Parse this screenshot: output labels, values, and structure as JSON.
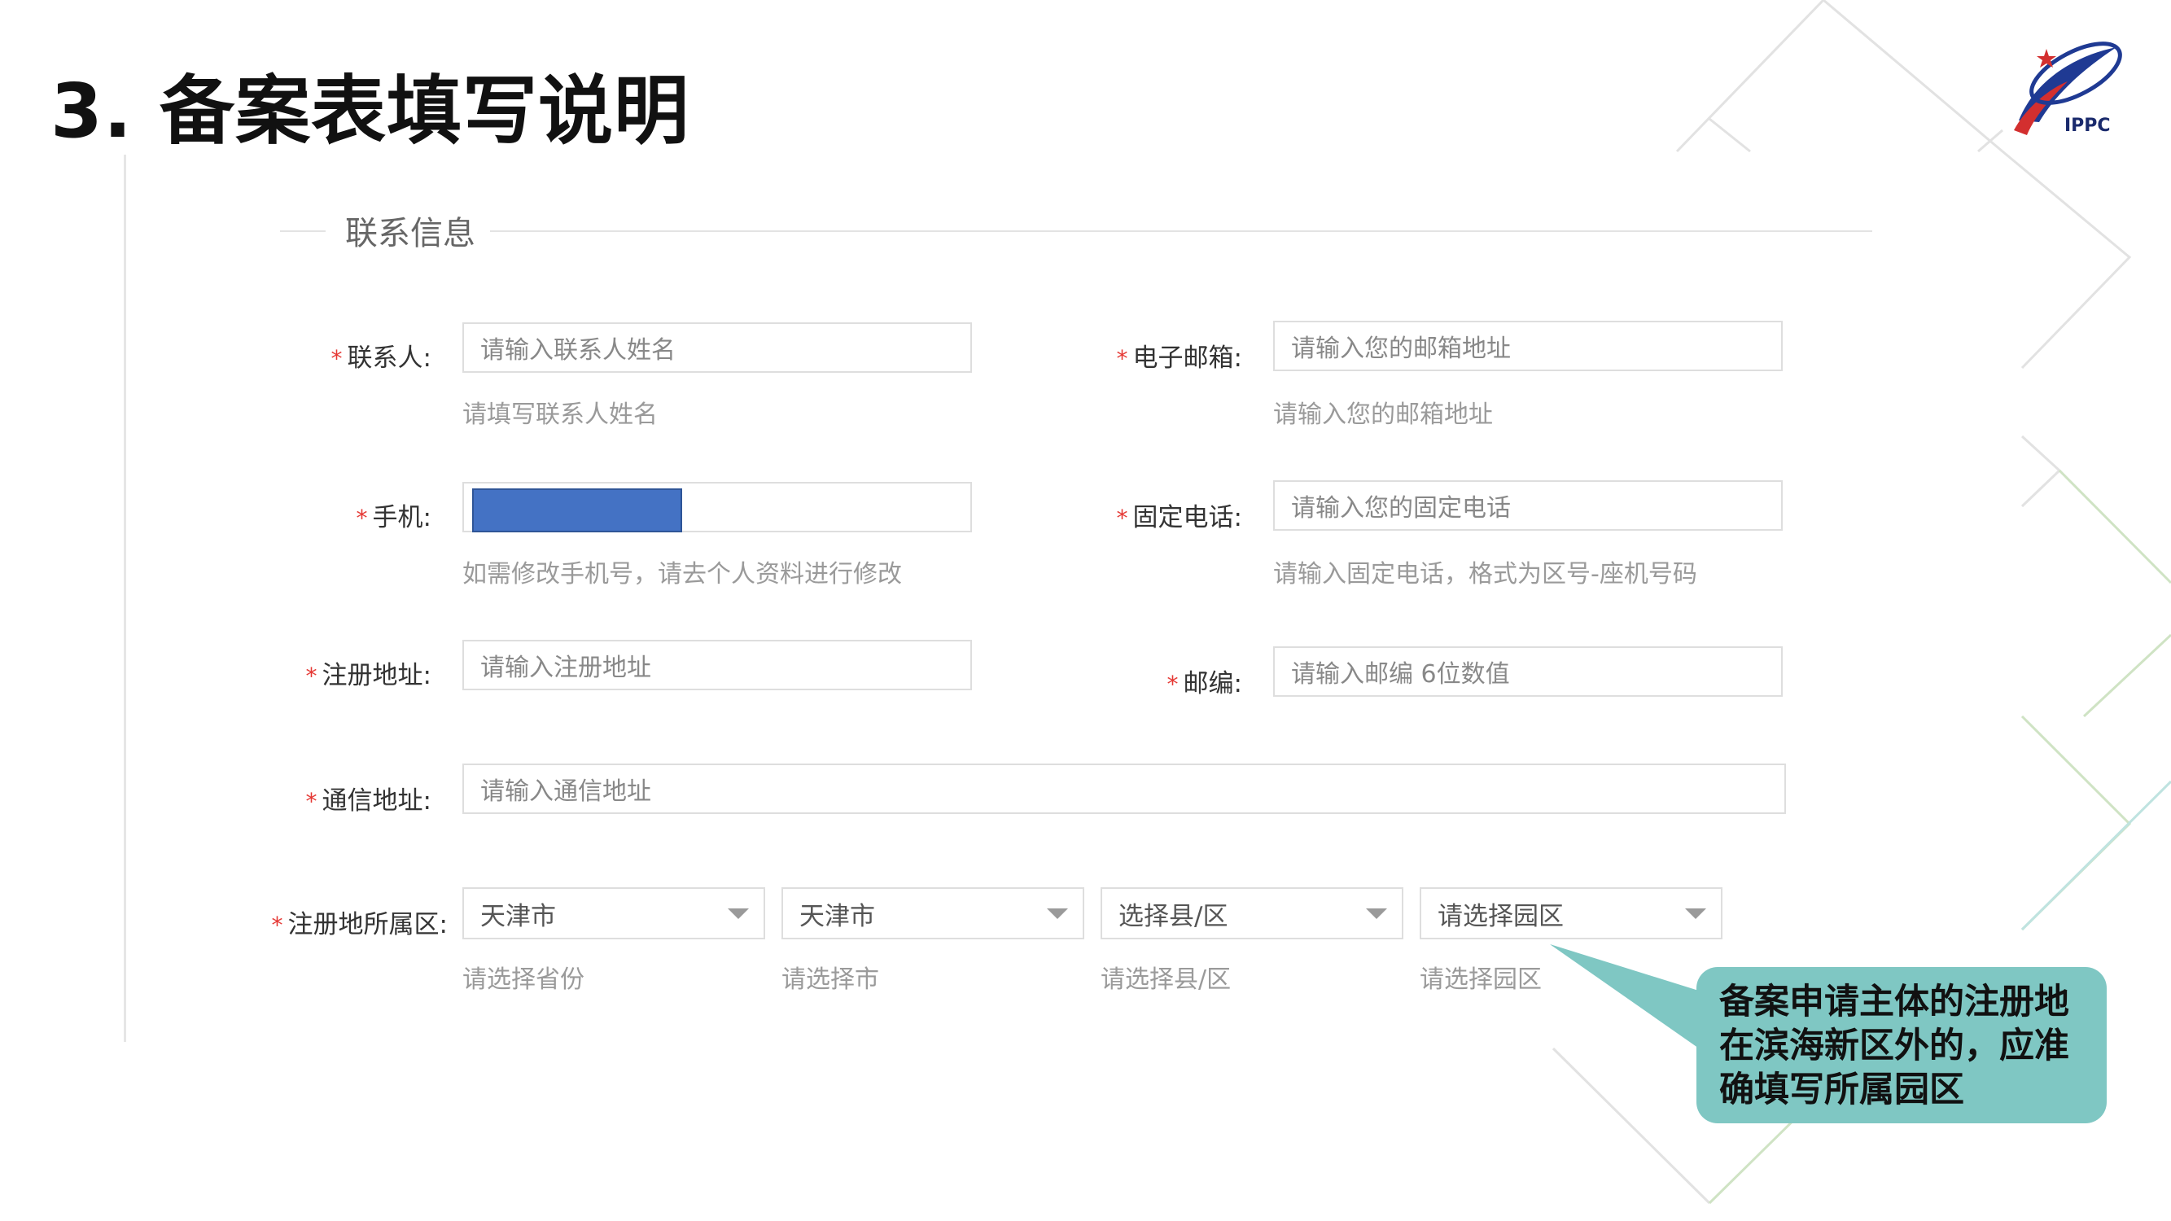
{
  "slide": {
    "title": "3. 备案表填写说明"
  },
  "logo": {
    "text": "IPPC"
  },
  "section": {
    "title": "联系信息"
  },
  "fields": {
    "contact": {
      "label": "联系人:",
      "placeholder": "请输入联系人姓名",
      "hint": "请填写联系人姓名"
    },
    "email": {
      "label": "电子邮箱:",
      "placeholder": "请输入您的邮箱地址",
      "hint": "请输入您的邮箱地址"
    },
    "mobile": {
      "label": "手机:",
      "hint": "如需修改手机号，请去个人资料进行修改"
    },
    "landline": {
      "label": "固定电话:",
      "placeholder": "请输入您的固定电话",
      "hint": "请输入固定电话，格式为区号-座机号码"
    },
    "reg_address": {
      "label": "注册地址:",
      "placeholder": "请输入注册地址"
    },
    "postcode": {
      "label": "邮编:",
      "placeholder": "请输入邮编 6位数值"
    },
    "mail_address": {
      "label": "通信地址:",
      "placeholder": "请输入通信地址"
    },
    "region": {
      "label": "注册地所属区:",
      "selects": [
        {
          "value": "天津市",
          "hint": "请选择省份"
        },
        {
          "value": "天津市",
          "hint": "请选择市"
        },
        {
          "value": "选择县/区",
          "hint": "请选择县/区"
        },
        {
          "value": "请选择园区",
          "hint": "请选择园区"
        }
      ]
    }
  },
  "required_mark": "*",
  "callout": {
    "text": "备案申请主体的注册地在滨海新区外的，应准确填写所属园区"
  },
  "colors": {
    "callout": "#7fc7c3",
    "required": "#e53935",
    "masked": "#4472c4"
  }
}
